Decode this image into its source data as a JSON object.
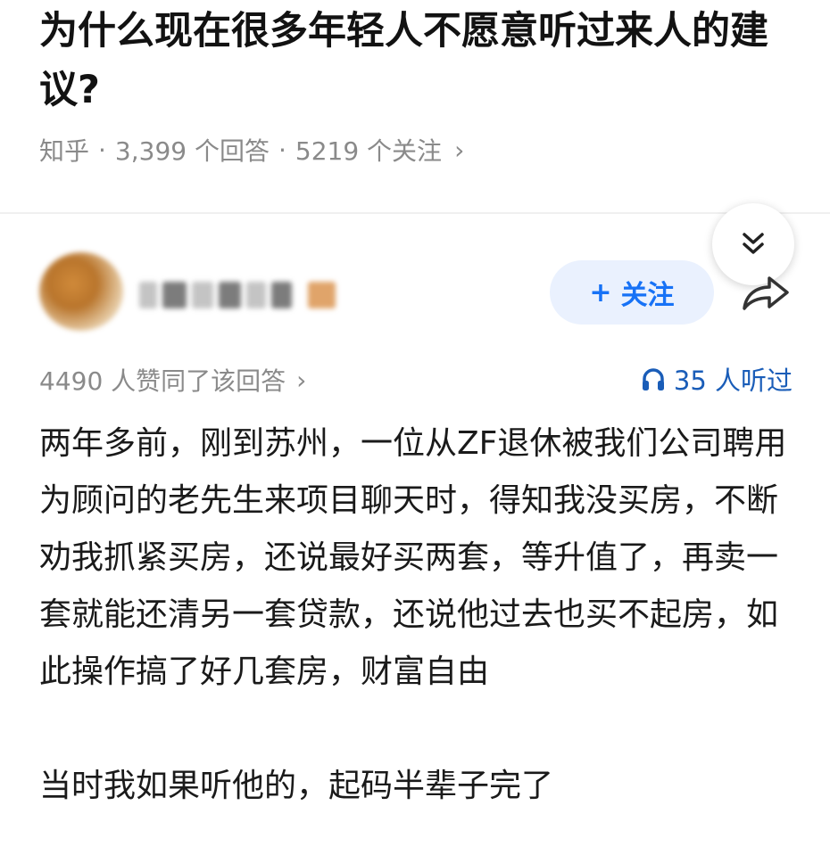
{
  "question": {
    "title": "为什么现在很多年轻人不愿意听过来人的建议?"
  },
  "meta": {
    "source": "知乎",
    "answers": "3,399 个回答",
    "followers": "5219 个关注",
    "chevron": "›"
  },
  "author": {
    "follow_label": "关注",
    "follow_plus": "+"
  },
  "stats": {
    "likes": "4490 人赞同了该回答",
    "likes_chevron": "›",
    "listened": "35 人听过"
  },
  "answer": {
    "paragraph1": "两年多前，刚到苏州，一位从ZF退休被我们公司聘用为顾问的老先生来项目聊天时，得知我没买房，不断劝我抓紧买房，还说最好买两套，等升值了，再卖一套就能还清另一套贷款，还说他过去也买不起房，如此操作搞了好几套房，财富自由",
    "paragraph2": "当时我如果听他的，起码半辈子完了"
  },
  "icons": {
    "collapse": "chevron-double-down-icon",
    "share": "share-arrow-icon",
    "headphones": "headphones-icon"
  },
  "colors": {
    "accent": "#1772f6",
    "follow_bg": "#eaf1fe",
    "muted": "#8a8a8a"
  }
}
